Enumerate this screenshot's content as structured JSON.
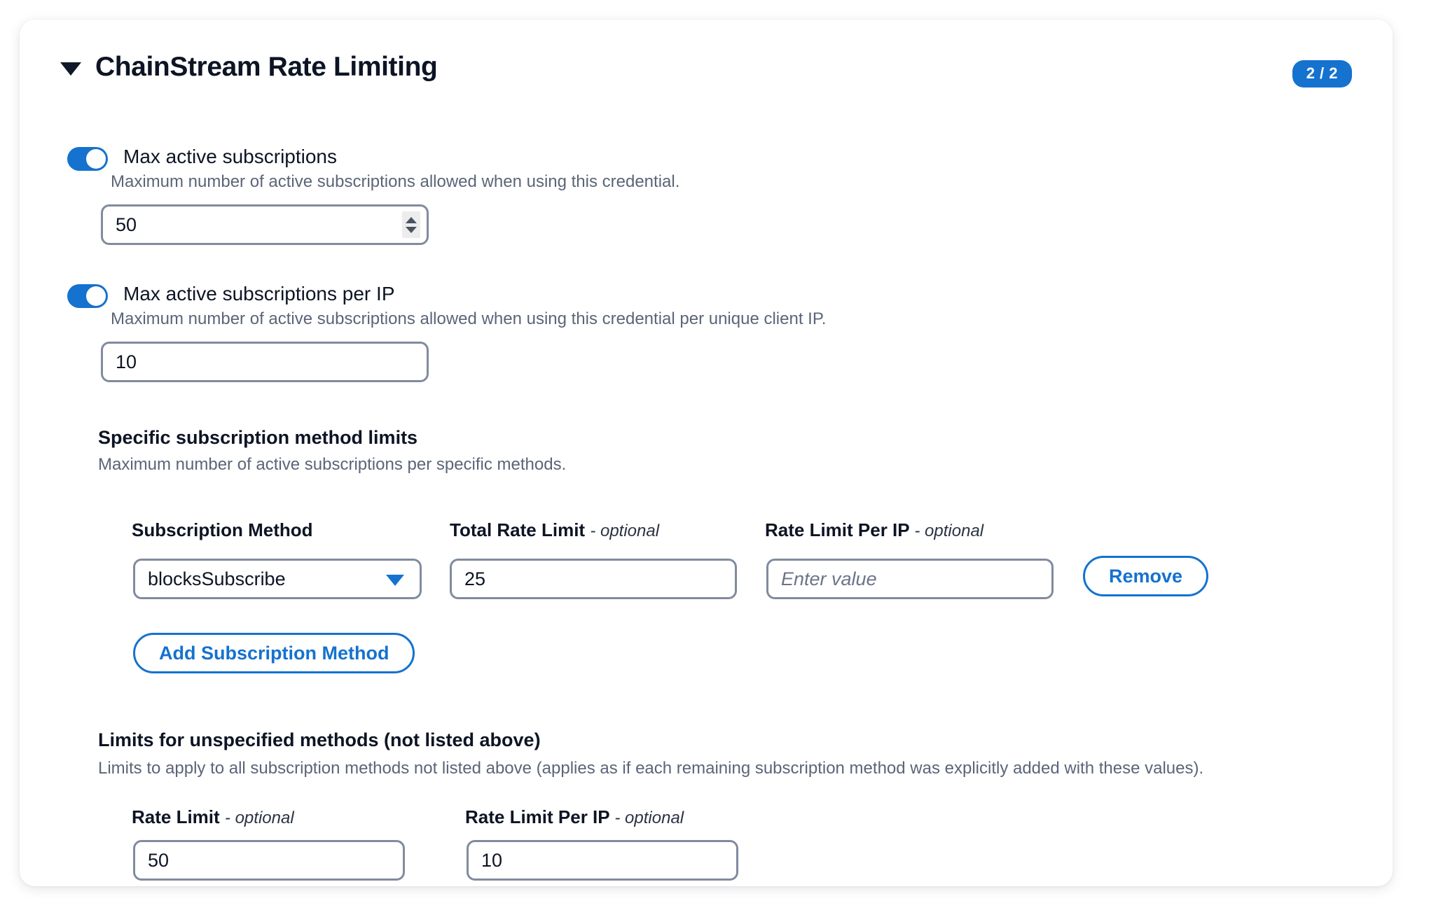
{
  "card": {
    "title": "ChainStream Rate Limiting",
    "collapse_icon": "caret-down-icon",
    "badge": "2 / 2"
  },
  "settings": [
    {
      "label": "Max active subscriptions",
      "helper": "Maximum number of active subscriptions allowed when using this credential.",
      "enabled": true,
      "value": "50",
      "has_spinner": true
    },
    {
      "label": "Max active subscriptions per IP",
      "helper": "Maximum number of active subscriptions allowed when using this credential per unique client IP.",
      "enabled": true,
      "value": "10",
      "has_spinner": false
    }
  ],
  "specific_methods": {
    "title": "Specific subscription method limits",
    "helper": "Maximum number of active subscriptions per specific methods.",
    "columns": {
      "method": "Subscription Method",
      "total": "Total Rate Limit",
      "total_opt": "- optional",
      "per_ip": "Rate Limit Per IP",
      "per_ip_opt": "- optional"
    },
    "rows": [
      {
        "method": "blocksSubscribe",
        "total_rate_limit": "25",
        "rate_limit_per_ip": "",
        "rate_limit_per_ip_placeholder": "Enter value",
        "remove_label": "Remove"
      }
    ],
    "add_label": "Add Subscription Method"
  },
  "unspecified": {
    "title": "Limits for unspecified methods (not listed above)",
    "helper": "Limits to apply to all subscription methods not listed above (applies as if each remaining subscription method was explicitly added with these values).",
    "rate_limit_label": "Rate Limit",
    "rate_limit_opt": "- optional",
    "rate_limit_value": "50",
    "per_ip_label": "Rate Limit Per IP",
    "per_ip_opt": "- optional",
    "per_ip_value": "10"
  },
  "colors": {
    "accent": "#1572ce",
    "text": "#0d1424",
    "muted": "#5b6578",
    "border": "#808b9e"
  }
}
